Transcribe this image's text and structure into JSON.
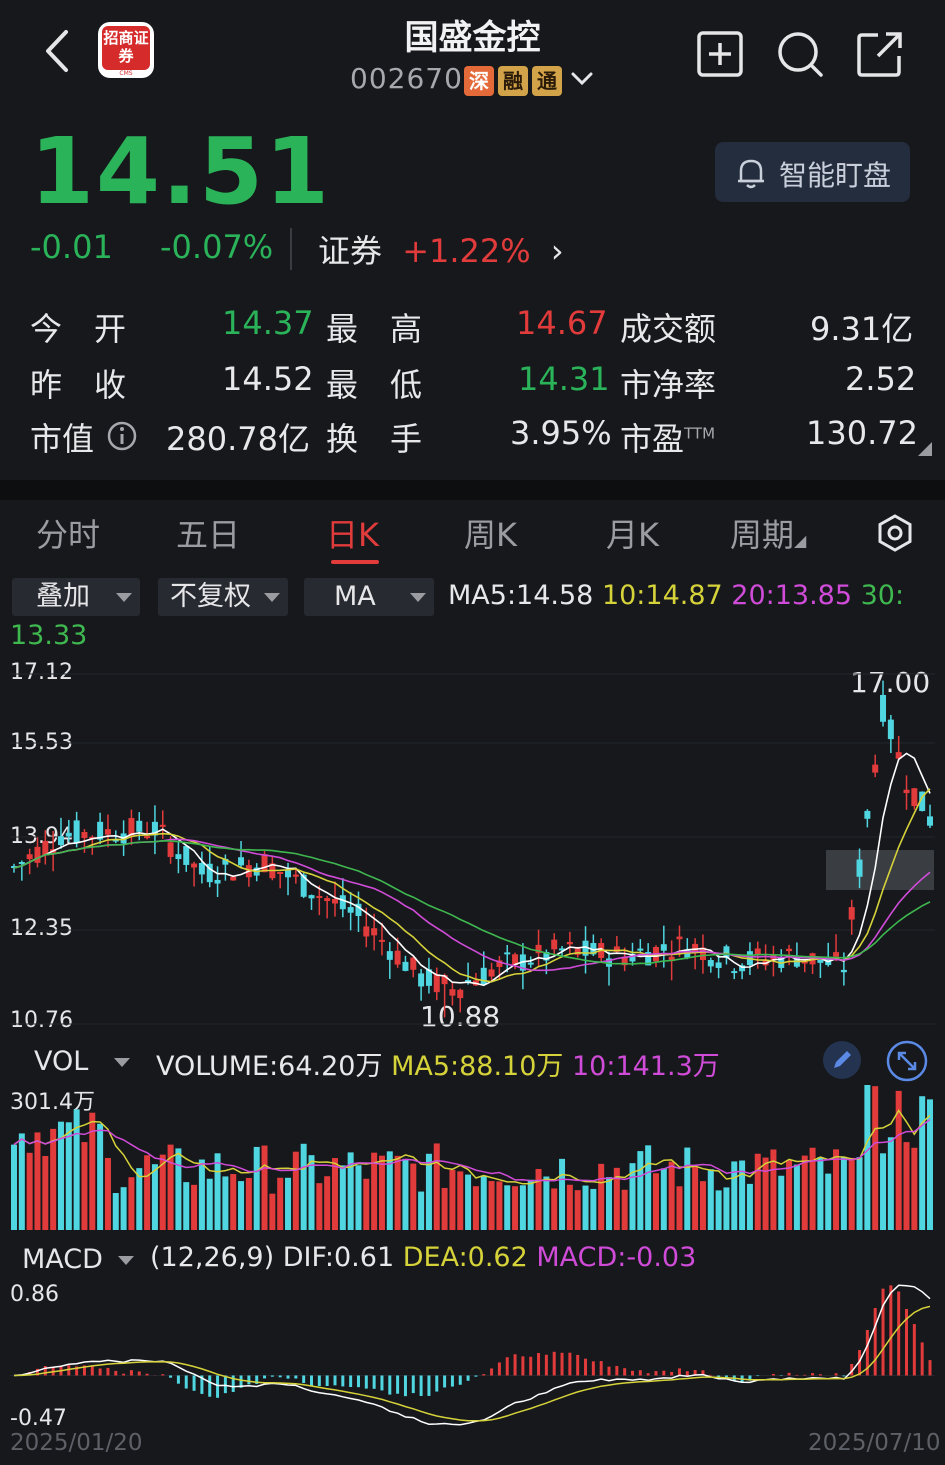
{
  "header": {
    "title": "国盛金控",
    "code": "002670",
    "tags": [
      "深",
      "融",
      "通"
    ],
    "logo_text": "招商证券",
    "logo_sub": "CMS"
  },
  "quote": {
    "price": "14.51",
    "change": "-0.01",
    "change_pct": "-0.07%",
    "sector_label": "证券",
    "sector_change": "+1.22%",
    "smart_button": "智能盯盘"
  },
  "stats": {
    "open_label": "今　开",
    "open": "14.37",
    "high_label": "最　高",
    "high": "14.67",
    "amount_label": "成交额",
    "amount": "9.31亿",
    "prev_label": "昨　收",
    "prev": "14.52",
    "low_label": "最　低",
    "low": "14.31",
    "pb_label": "市净率",
    "pb": "2.52",
    "mcap_label": "市值",
    "mcap": "280.78亿",
    "turnover_label": "换　手",
    "turnover": "3.95%",
    "pe_label": "市盈",
    "pe_sup": "TTM",
    "pe": "130.72"
  },
  "tabs": [
    "分时",
    "五日",
    "日K",
    "周K",
    "月K",
    "周期"
  ],
  "toolbar": {
    "overlay": "叠加",
    "adjust": "不复权",
    "indicator": "MA"
  },
  "ma_legend": {
    "ma5": "MA5:14.58",
    "ma10": "10:14.87",
    "ma20": "20:13.85",
    "ma30_label": "30:",
    "ma30": "13.33"
  },
  "kline_axis": {
    "y1": "17.12",
    "y2": "15.53",
    "y3": "13.94",
    "y4": "12.35",
    "y5": "10.76",
    "max_label": "17.00",
    "min_label": "10.88"
  },
  "vol_legend": {
    "selector": "VOL",
    "volume": "VOLUME:64.20万",
    "ma5": "MA5:88.10万",
    "ma10": "10:141.3万",
    "max": "301.4万"
  },
  "macd_legend": {
    "selector": "MACD",
    "params": "(12,26,9)",
    "dif": "DIF:0.61",
    "dea": "DEA:0.62",
    "macd": "MACD:-0.03",
    "max": "0.86",
    "min": "-0.47"
  },
  "dates": {
    "start": "2025/01/20",
    "end": "2025/07/10"
  },
  "colors": {
    "up": "#e23b3b",
    "down": "#4fd6e0",
    "ma5": "#ffffff",
    "ma10": "#d6d23a",
    "ma20": "#d04cd8",
    "ma30": "#3fb84f"
  },
  "chart_data": {
    "type": "candlestick",
    "title": "",
    "ylim": [
      10.76,
      17.12
    ],
    "high_marker": 17.0,
    "low_marker": 10.88,
    "x_range": [
      "2025/01/20",
      "2025/07/10"
    ],
    "last_close": 14.51,
    "ma": {
      "ma5": 14.58,
      "ma10": 14.87,
      "ma20": 13.85,
      "ma30": 13.33
    },
    "volume": {
      "last": "64.20万",
      "ma5": "88.10万",
      "ma10": "141.3万",
      "max": "301.4万"
    },
    "macd": {
      "params": "12,26,9",
      "dif": 0.61,
      "dea": 0.62,
      "macd": -0.03,
      "ylim": [
        -0.47,
        0.86
      ]
    }
  }
}
